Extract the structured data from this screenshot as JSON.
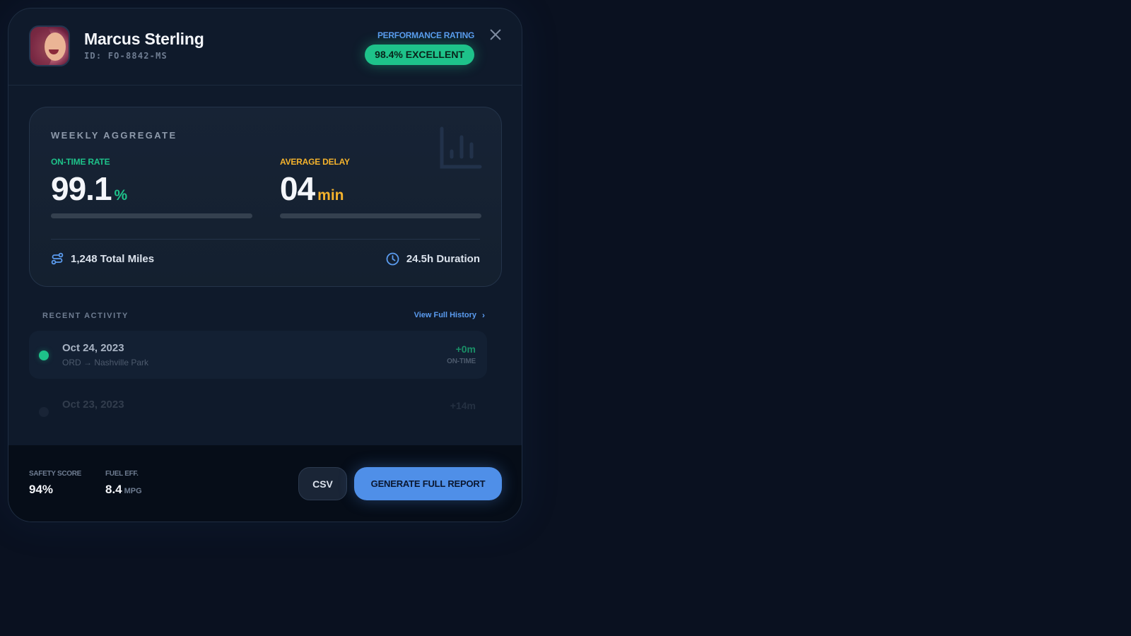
{
  "driver": {
    "name": "Marcus Sterling",
    "id": "ID: FO-8842-MS"
  },
  "performance": {
    "label": "PERFORMANCE RATING",
    "badge": "98.4% EXCELLENT"
  },
  "weekly": {
    "title": "WEEKLY AGGREGATE",
    "on_time": {
      "label": "ON-TIME RATE",
      "value": "99.1",
      "unit": "%"
    },
    "avg_delay": {
      "label": "AVERAGE DELAY",
      "value": "04",
      "unit": "min"
    },
    "total_miles": "1,248 Total Miles",
    "duration": "24.5h Duration"
  },
  "recent_activity": {
    "title": "RECENT ACTIVITY",
    "link": "View Full History",
    "items": [
      {
        "date": "Oct 24, 2023",
        "route": "ORD → Nashville Park",
        "delta": "+0m",
        "status": "ON-TIME"
      },
      {
        "date": "Oct 23, 2023",
        "route": "",
        "delta": "+14m",
        "status": ""
      }
    ]
  },
  "footer": {
    "safety": {
      "label": "SAFETY SCORE",
      "value": "94%"
    },
    "fuel": {
      "label": "FUEL EFF.",
      "value": "8.4",
      "unit": "MPG"
    },
    "csv_label": "CSV",
    "report_label": "GENERATE FULL REPORT"
  },
  "colors": {
    "accent_green": "#1ec28a",
    "accent_amber": "#f5b32c",
    "accent_blue": "#4f8fe8",
    "background": "#0a1120"
  }
}
